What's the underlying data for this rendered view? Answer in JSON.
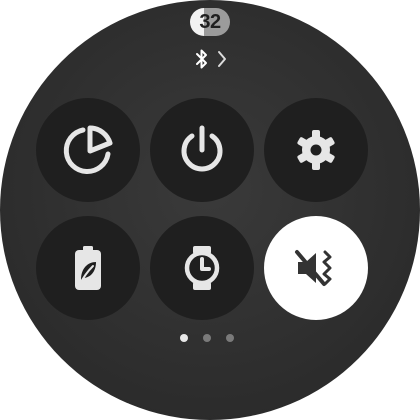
{
  "status": {
    "battery_percent": "32",
    "bluetooth_icon": "bluetooth-icon",
    "expand_icon": "chevron-right-icon"
  },
  "tiles": [
    {
      "icon": "data-usage-icon",
      "active": false
    },
    {
      "icon": "power-icon",
      "active": false
    },
    {
      "icon": "settings-gear-icon",
      "active": false
    },
    {
      "icon": "power-saving-battery-leaf-icon",
      "active": false
    },
    {
      "icon": "watch-only-mode-icon",
      "active": false
    },
    {
      "icon": "sound-mute-vibrate-icon",
      "active": true
    }
  ],
  "pagination": {
    "pages": 3,
    "current": 1
  },
  "colors": {
    "background": "#2f2f2f",
    "tile": "#1f1f1f",
    "active_tile": "#ffffff",
    "icon": "#e6e6e6",
    "active_icon": "#333333"
  }
}
